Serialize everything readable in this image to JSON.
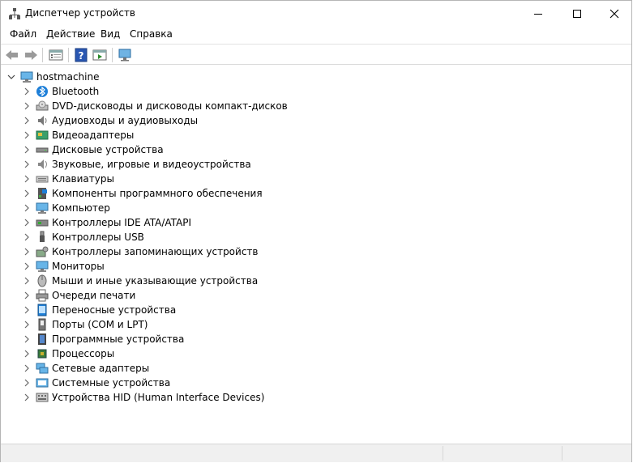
{
  "window": {
    "title": "Диспетчер устройств"
  },
  "menu": [
    "Файл",
    "Действие",
    "Вид",
    "Справка"
  ],
  "toolbar": {
    "buttons": [
      "back-icon",
      "forward-icon",
      "properties-icon",
      "help-icon",
      "action-icon",
      "scan-hardware-icon"
    ]
  },
  "tree": {
    "root": {
      "label": "hostmachine",
      "icon": "computer-icon"
    },
    "categories": [
      {
        "label": "Bluetooth",
        "icon": "bluetooth-icon"
      },
      {
        "label": "DVD-дисководы и дисководы компакт-дисков",
        "icon": "dvd-drive-icon"
      },
      {
        "label": "Аудиовходы и аудиовыходы",
        "icon": "speaker-icon"
      },
      {
        "label": "Видеоадаптеры",
        "icon": "display-adapter-icon"
      },
      {
        "label": "Дисковые устройства",
        "icon": "disk-drive-icon"
      },
      {
        "label": "Звуковые, игровые и видеоустройства",
        "icon": "sound-icon"
      },
      {
        "label": "Клавиатуры",
        "icon": "keyboard-icon"
      },
      {
        "label": "Компоненты программного обеспечения",
        "icon": "software-component-icon"
      },
      {
        "label": "Компьютер",
        "icon": "monitor-icon"
      },
      {
        "label": "Контроллеры IDE ATA/ATAPI",
        "icon": "ide-controller-icon"
      },
      {
        "label": "Контроллеры USB",
        "icon": "usb-icon"
      },
      {
        "label": "Контроллеры запоминающих устройств",
        "icon": "storage-controller-icon"
      },
      {
        "label": "Мониторы",
        "icon": "monitor-icon"
      },
      {
        "label": "Мыши и иные указывающие устройства",
        "icon": "mouse-icon"
      },
      {
        "label": "Очереди печати",
        "icon": "printer-icon"
      },
      {
        "label": "Переносные устройства",
        "icon": "portable-device-icon"
      },
      {
        "label": "Порты (COM и LPT)",
        "icon": "port-icon"
      },
      {
        "label": "Программные устройства",
        "icon": "software-device-icon"
      },
      {
        "label": "Процессоры",
        "icon": "processor-icon"
      },
      {
        "label": "Сетевые адаптеры",
        "icon": "network-adapter-icon"
      },
      {
        "label": "Системные устройства",
        "icon": "system-device-icon"
      },
      {
        "label": "Устройства HID (Human Interface Devices)",
        "icon": "hid-icon"
      }
    ]
  }
}
